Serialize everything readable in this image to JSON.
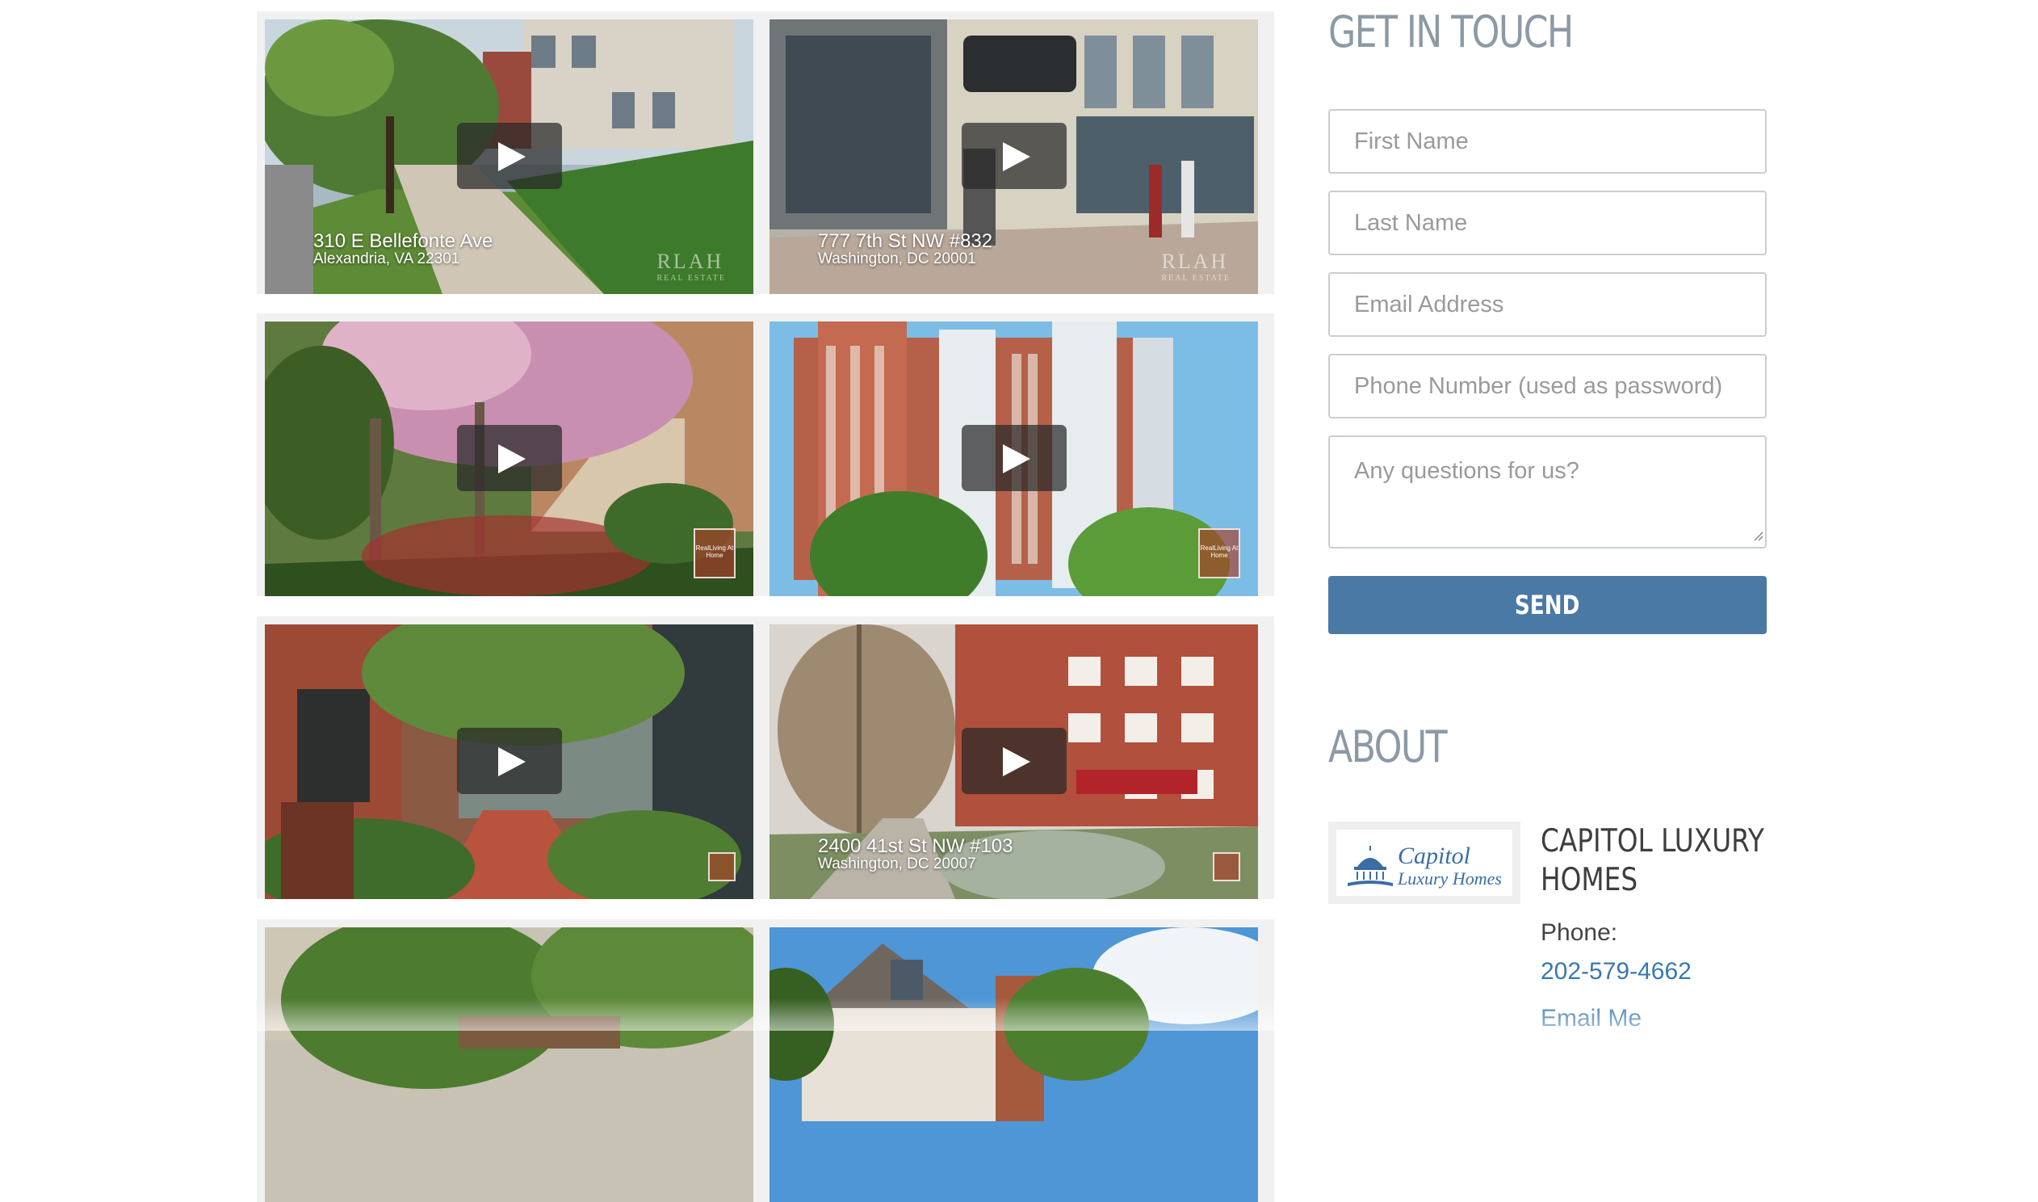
{
  "contact": {
    "title": "GET IN TOUCH",
    "first_name_placeholder": "First Name",
    "last_name_placeholder": "Last Name",
    "email_placeholder": "Email Address",
    "phone_placeholder": "Phone Number (used as password)",
    "questions_placeholder": "Any questions for us?",
    "send_label": "SEND",
    "accent_color": "#4a79a5"
  },
  "about": {
    "title": "ABOUT",
    "logo_line1": "Capitol",
    "logo_line2": "Luxury Homes",
    "company_name": "CAPITOL LUXURY HOMES",
    "phone_label": "Phone:",
    "phone": "202-579-4662",
    "email_link": "Email Me"
  },
  "videos": [
    {
      "address": "310 E Bellefonte Ave",
      "city": "Alexandria, VA 22301",
      "watermark": "RLAH",
      "watermark_sub": "REAL ESTATE"
    },
    {
      "address": "777 7th St NW #832",
      "city": "Washington, DC 20001",
      "watermark": "RLAH",
      "watermark_sub": "REAL ESTATE"
    },
    {
      "address": "",
      "city": "",
      "badge": "RealLiving At Home"
    },
    {
      "address": "",
      "city": "",
      "badge": "RealLiving At Home"
    },
    {
      "address": "",
      "city": "",
      "badge": ""
    },
    {
      "address": "2400 41st St NW #103",
      "city": "Washington, DC 20007",
      "badge": ""
    },
    {
      "address": "",
      "city": ""
    },
    {
      "address": "",
      "city": ""
    }
  ]
}
